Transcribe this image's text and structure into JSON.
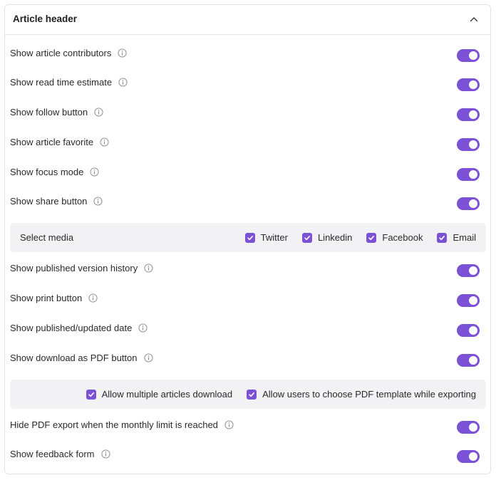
{
  "panel": {
    "title": "Article header",
    "collapse_icon": "chevron-up-icon"
  },
  "colors": {
    "accent": "#7b51d6",
    "subbox_bg": "#f2f2f4"
  },
  "settings": [
    {
      "label": "Show article contributors",
      "enabled": true
    },
    {
      "label": "Show read time estimate",
      "enabled": true
    },
    {
      "label": "Show follow button",
      "enabled": true
    },
    {
      "label": "Show article favorite",
      "enabled": true
    },
    {
      "label": "Show focus mode",
      "enabled": true
    },
    {
      "label": "Show share button",
      "enabled": true
    },
    {
      "label": "Show published version history",
      "enabled": true
    },
    {
      "label": "Show print button",
      "enabled": true
    },
    {
      "label": "Show published/updated date",
      "enabled": true
    },
    {
      "label": "Show download as PDF button",
      "enabled": true
    },
    {
      "label": "Hide PDF export when the monthly limit is reached",
      "enabled": true
    },
    {
      "label": "Show feedback form",
      "enabled": true
    }
  ],
  "media": {
    "label": "Select media",
    "options": [
      {
        "label": "Twitter",
        "checked": true
      },
      {
        "label": "Linkedin",
        "checked": true
      },
      {
        "label": "Facebook",
        "checked": true
      },
      {
        "label": "Email",
        "checked": true
      }
    ]
  },
  "pdf_options": [
    {
      "label": "Allow multiple articles download",
      "checked": true
    },
    {
      "label": "Allow users to choose PDF template while exporting",
      "checked": true
    }
  ]
}
